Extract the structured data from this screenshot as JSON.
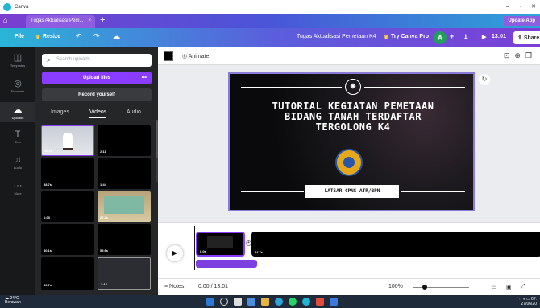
{
  "window": {
    "app_name": "Canva",
    "controls": [
      "–",
      "▫",
      "✕"
    ]
  },
  "tabs": {
    "active_label": "Tugas Aktualisasi Pem...",
    "close": "×",
    "new_tab": "+",
    "update_label": "Update App"
  },
  "toolbar": {
    "file": "File",
    "resize": "Resize",
    "undo": "↶",
    "redo": "↷",
    "doc_title": "Tugas Aktualisasi Pemetaan K4",
    "try_pro": "Try Canva Pro",
    "avatar_initial": "A",
    "add": "+",
    "duration": "13:01",
    "share": "Share"
  },
  "rail": [
    {
      "label": "Templates",
      "icon": "templates-icon"
    },
    {
      "label": "Elements",
      "icon": "elements-icon"
    },
    {
      "label": "Uploads",
      "icon": "uploads-icon"
    },
    {
      "label": "Text",
      "icon": "text-icon"
    },
    {
      "label": "Audio",
      "icon": "audio-icon"
    },
    {
      "label": "More",
      "icon": "more-icon"
    }
  ],
  "panel": {
    "search_placeholder": "Search uploads",
    "upload_button": "Upload files",
    "more": "•••",
    "record_button": "Record yourself",
    "tabs": [
      "Images",
      "Videos",
      "Audio"
    ],
    "active_tab": "Videos",
    "thumbs": [
      {
        "duration": "24.4s"
      },
      {
        "duration": "2:11"
      },
      {
        "duration": "38.7s"
      },
      {
        "duration": "1:44"
      },
      {
        "duration": "1:00"
      },
      {
        "duration": "27.2s"
      },
      {
        "duration": "30.1s"
      },
      {
        "duration": "59.6s"
      },
      {
        "duration": "49.7s"
      },
      {
        "duration": "1:16"
      }
    ]
  },
  "context_bar": {
    "animate": "Animate"
  },
  "slide": {
    "heading_lines": [
      "TUTORIAL KEGIATAN PEMETAAN",
      "BIDANG TANAH TERDAFTAR",
      "TERGOLONG K4"
    ],
    "subtitle": "LATSAR CPNS ATR/BPN"
  },
  "timeline": {
    "clip1_duration": "0.0s",
    "clip2_duration": "44.7s"
  },
  "footer": {
    "notes": "Notes",
    "time": "0:00 / 13:01",
    "zoom": "100%"
  },
  "taskbar": {
    "temp": "24°C",
    "weather": "Berawan",
    "clock": "07:",
    "date": "27/06/20"
  },
  "colors": {
    "brand_purple": "#8b3dff",
    "panel_bg": "#252627",
    "rail_bg": "#18191b",
    "taskbar": "#1f2a3a"
  }
}
